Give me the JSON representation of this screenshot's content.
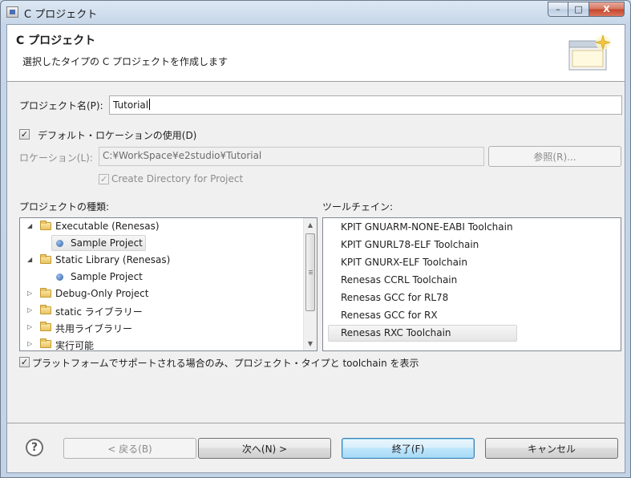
{
  "window": {
    "title": "C プロジェクト",
    "controls": {
      "minimize": "–",
      "maximize": "□",
      "close": "X"
    }
  },
  "banner": {
    "title": "C プロジェクト",
    "description": "選択したタイプの C プロジェクトを作成します"
  },
  "project_name": {
    "label": "プロジェクト名(P):",
    "value": "Tutorial"
  },
  "default_location": {
    "label": "デフォルト・ロケーションの使用(D)",
    "checked": true
  },
  "location": {
    "label": "ロケーション(L):",
    "value": "C:¥WorkSpace¥e2studio¥Tutorial",
    "browse_label": "参照(R)..."
  },
  "create_directory": {
    "label": "Create Directory for Project",
    "checked": true
  },
  "project_types": {
    "label": "プロジェクトの種類:",
    "items": [
      {
        "label": "Executable (Renesas)",
        "expanded": true,
        "children": [
          "Sample Project"
        ]
      },
      {
        "label": "Static Library (Renesas)",
        "expanded": true,
        "children": [
          "Sample Project"
        ]
      },
      {
        "label": "Debug-Only Project",
        "expanded": false
      },
      {
        "label": "static ライブラリー",
        "expanded": false
      },
      {
        "label": "共用ライブラリー",
        "expanded": false
      },
      {
        "label": "実行可能",
        "expanded": false
      }
    ],
    "selected": "Executable (Renesas) / Sample Project"
  },
  "toolchains": {
    "label": "ツールチェイン:",
    "items": [
      "KPIT GNUARM-NONE-EABI Toolchain",
      "KPIT GNURL78-ELF Toolchain",
      "KPIT GNURX-ELF Toolchain",
      "Renesas CCRL Toolchain",
      "Renesas GCC for RL78",
      "Renesas GCC for RX",
      "Renesas RXC Toolchain"
    ],
    "selected": "Renesas RXC Toolchain"
  },
  "platform_filter": {
    "label": "プラットフォームでサポートされる場合のみ、プロジェクト・タイプと toolchain を表示",
    "checked": true
  },
  "footer": {
    "help": "?",
    "back": "< 戻る(B)",
    "next": "次へ(N) >",
    "finish": "終了(F)",
    "cancel": "キャンセル"
  },
  "icons": {
    "checkmark": "✓",
    "expanded": "◢",
    "collapsed": "▷",
    "scroll_up": "▲",
    "scroll_down": "▼"
  }
}
